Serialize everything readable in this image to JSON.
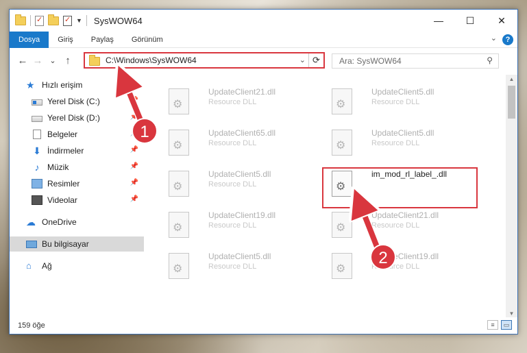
{
  "window": {
    "title": "SysWOW64",
    "minimize_glyph": "—",
    "maximize_glyph": "☐",
    "close_glyph": "✕"
  },
  "ribbon": {
    "tabs": [
      {
        "label": "Dosya",
        "active": true
      },
      {
        "label": "Giriş"
      },
      {
        "label": "Paylaş"
      },
      {
        "label": "Görünüm"
      }
    ],
    "collapse_glyph": "⌄",
    "help_glyph": "?"
  },
  "nav": {
    "back_glyph": "←",
    "forward_glyph": "→",
    "recent_glyph": "⌄",
    "up_glyph": "↑",
    "address": "C:\\Windows\\SysWOW64",
    "address_dropdown_glyph": "⌄",
    "refresh_glyph": "⟳",
    "search_placeholder": "Ara: SysWOW64",
    "search_glyph": "⚲"
  },
  "sidebar": {
    "items": [
      {
        "label": "Hızlı erişim",
        "icon": "star-icon"
      },
      {
        "label": "Yerel Disk (C:)",
        "icon": "drive-icon",
        "pinned": true
      },
      {
        "label": "Yerel Disk (D:)",
        "icon": "drive-icon",
        "pinned": true
      },
      {
        "label": "Belgeler",
        "icon": "documents-icon",
        "pinned": true
      },
      {
        "label": "İndirmeler",
        "icon": "downloads-icon",
        "pinned": true
      },
      {
        "label": "Müzik",
        "icon": "music-icon",
        "pinned": true
      },
      {
        "label": "Resimler",
        "icon": "pictures-icon",
        "pinned": true
      },
      {
        "label": "Videolar",
        "icon": "videos-icon",
        "pinned": true
      },
      {
        "label": "OneDrive",
        "icon": "onedrive-icon"
      },
      {
        "label": "Bu bilgisayar",
        "icon": "this-pc-icon",
        "selected": true
      },
      {
        "label": "Ağ",
        "icon": "network-icon"
      }
    ],
    "pin_glyph": "📌"
  },
  "files": [
    {
      "name": "UpdateClient21.dll",
      "type": "Resource DLL"
    },
    {
      "name": "UpdateClient5.dll",
      "type": "Resource DLL"
    },
    {
      "name": "UpdateClient65.dll",
      "type": "Resource DLL"
    },
    {
      "name": "UpdateClient5.dll",
      "type": "Resource DLL"
    },
    {
      "name": "UpdateClient5.dll",
      "type": "Resource DLL"
    },
    {
      "name": "im_mod_rl_label_.dll",
      "type": "",
      "highlighted": true
    },
    {
      "name": "UpdateClient19.dll",
      "type": "Resource DLL"
    },
    {
      "name": "UpdateClient21.dll",
      "type": "Resource DLL"
    },
    {
      "name": "UpdateClient5.dll",
      "type": "Resource DLL"
    },
    {
      "name": "UpdateClient19.dll",
      "type": "Resource DLL"
    }
  ],
  "status": {
    "count": "159 öğe"
  },
  "annotations": {
    "step1": "1",
    "step2": "2",
    "accent_color": "#d9363e"
  }
}
